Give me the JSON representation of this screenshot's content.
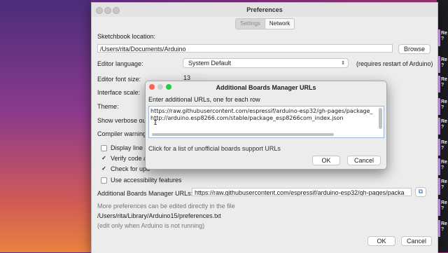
{
  "window": {
    "title": "Preferences",
    "tabs": [
      {
        "label": "Settings",
        "selected": true
      },
      {
        "label": "Network",
        "selected": false
      }
    ]
  },
  "settings": {
    "sketchbook_label": "Sketchbook location:",
    "sketchbook_path": "/Users/rita/Documents/Arduino",
    "browse_label": "Browse",
    "editor_language_label": "Editor language:",
    "editor_language_value": "System Default",
    "editor_language_note": "(requires restart of Arduino)",
    "font_size_label": "Editor font size:",
    "font_size_value": "13",
    "interface_scale_label": "Interface scale:",
    "theme_label": "Theme:",
    "verbose_label": "Show verbose out",
    "compiler_warning_label": "Compiler warning",
    "options": [
      {
        "label": "Display line n",
        "checked": false
      },
      {
        "label": "Verify code a",
        "checked": true
      },
      {
        "label": "Check for upd",
        "checked": true
      },
      {
        "label": "Use accessibility features",
        "checked": false
      }
    ],
    "boards_urls_label": "Additional Boards Manager URLs:",
    "boards_urls_value": "https://raw.githubusercontent.com/espressif/arduino-esp32/gh-pages/packa",
    "more_prefs_note": "More preferences can be edited directly in the file",
    "prefs_path": "/Users/rita/Library/Arduino15/preferences.txt",
    "edit_note": "(edit only when Arduino is not running)",
    "ok_label": "OK",
    "cancel_label": "Cancel"
  },
  "dialog": {
    "title": "Additional Boards Manager URLs",
    "instruction": "Enter additional URLs, one for each row",
    "urls": [
      "https://raw.githubusercontent.com/espressif/arduino-esp32/gh-pages/package_",
      "http://arduino.esp8266.com/stable/package_esp8266com_index.json"
    ],
    "link_text": "Click for a list of unofficial boards support URLs",
    "ok_label": "OK",
    "cancel_label": "Cancel"
  },
  "side_panel": {
    "items": [
      {
        "text": "Re\n?"
      },
      {
        "text": "Re\n?"
      },
      {
        "text": "Re\n?"
      },
      {
        "text": "Re\n?"
      },
      {
        "text": "Re\n?"
      },
      {
        "text": "Re\n?"
      },
      {
        "text": "Re\n?"
      },
      {
        "text": "Re\n?"
      },
      {
        "text": "Re\n?"
      },
      {
        "text": "Re\n?"
      }
    ]
  },
  "colors": {
    "close": "#fe5f57",
    "minimize": "#febc2e",
    "maximize": "#28c840",
    "accent": "#3b82f6"
  }
}
